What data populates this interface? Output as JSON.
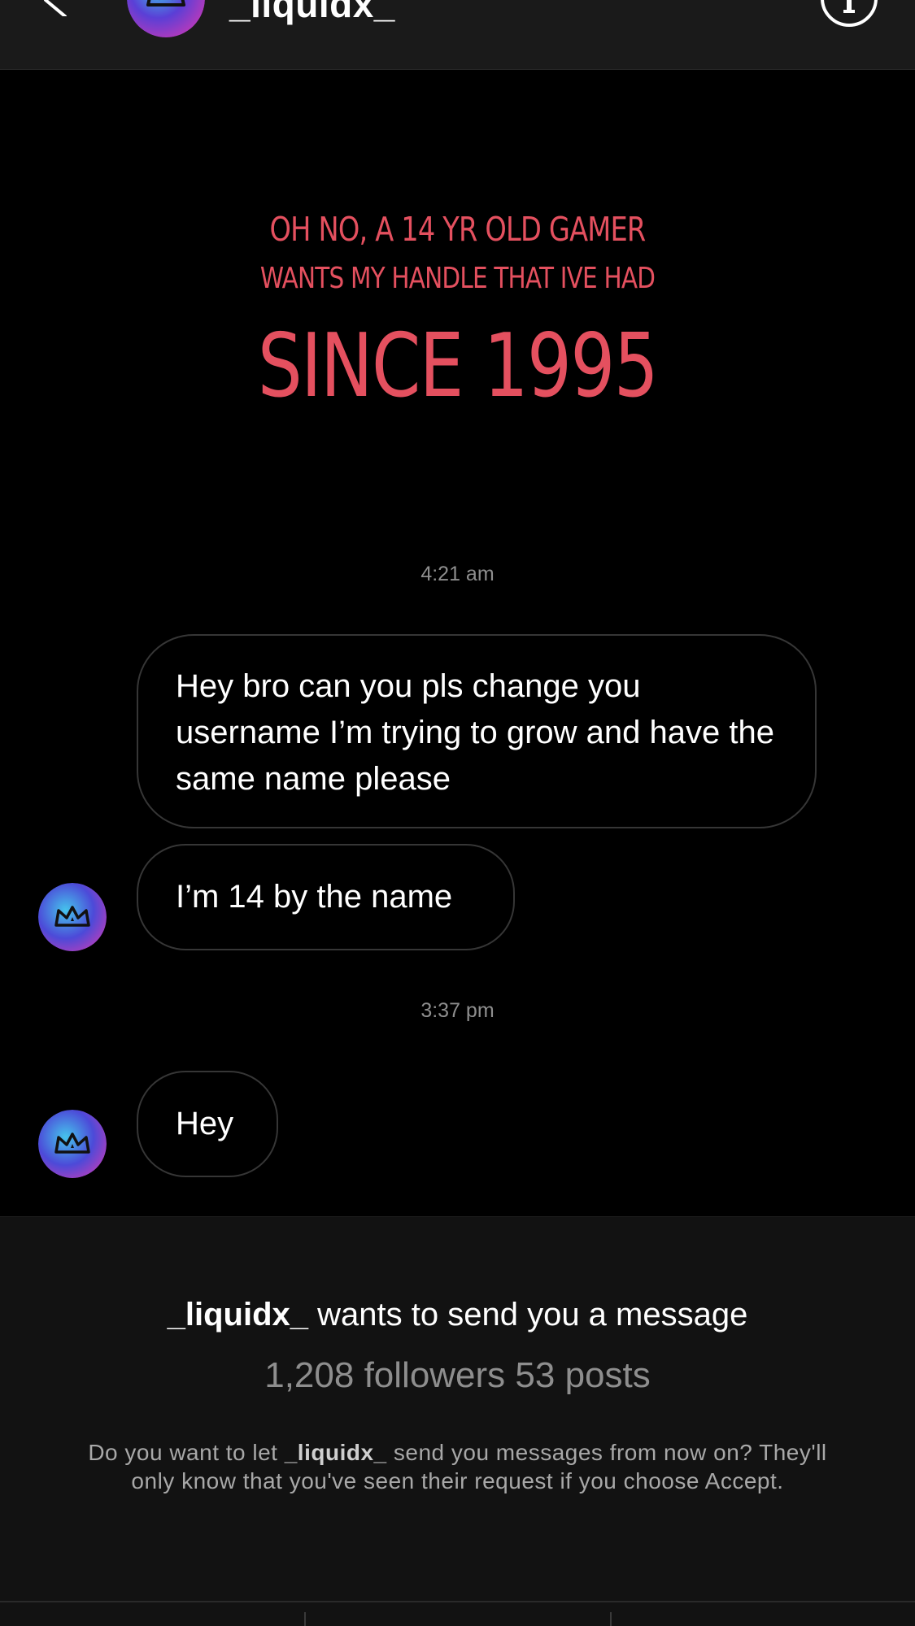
{
  "header": {
    "username": "_liquidx_"
  },
  "caption": {
    "line1": "OH NO, A 14 YR OLD GAMER",
    "line2": "WANTS MY HANDLE THAT IVE HAD",
    "line3": "SINCE 1995",
    "color": "#e4505f"
  },
  "thread": {
    "timestamp1": "4:21 am",
    "message1": "Hey bro can you pls change you username I’m trying to grow and have the same name please",
    "message2": "I’m 14 by the name",
    "timestamp2": "3:37 pm",
    "message3": "Hey"
  },
  "request": {
    "username": "_liquidx_",
    "title_suffix": " wants to send you a message",
    "stats": "1,208 followers 53 posts",
    "body_prefix": "Do you want to let ",
    "body_username": "_liquidx_",
    "body_suffix": " send you messages from now on? They'll only know that you've seen their request if you choose Accept."
  },
  "icons": {
    "back": "chevron-left-icon",
    "info": "info-icon",
    "avatar": "crown-galaxy-avatar"
  }
}
